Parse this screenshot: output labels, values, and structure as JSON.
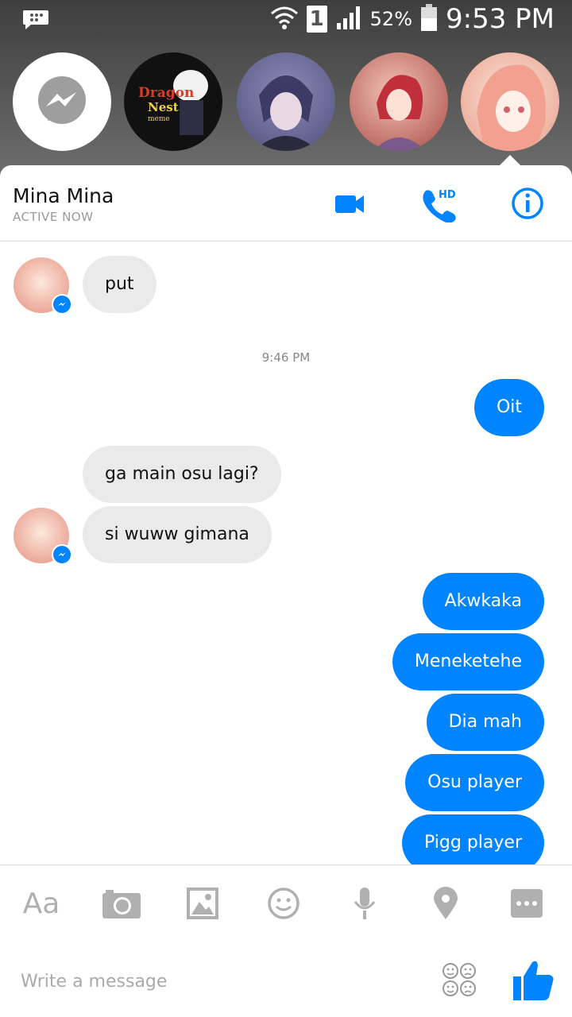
{
  "status_bar": {
    "battery_percent": "52%",
    "time": "9:53 PM",
    "sim_slot": "1"
  },
  "chat_heads": [
    {
      "name": "messenger-head",
      "icon": "messenger-icon"
    },
    {
      "name": "dragon-nest-head",
      "text": "Dragon Nest meme"
    },
    {
      "name": "contact-head-2"
    },
    {
      "name": "contact-head-3"
    },
    {
      "name": "contact-head-mina-active"
    }
  ],
  "header": {
    "contact_name": "Mina Mina",
    "status": "ACTIVE NOW",
    "call_hd_label": "HD"
  },
  "thread": {
    "timestamp": "9:46 PM",
    "messages": [
      {
        "from": "them",
        "text": "put"
      },
      {
        "from": "me",
        "text": "Oit"
      },
      {
        "from": "them",
        "text": "ga main osu lagi?"
      },
      {
        "from": "them",
        "text": "si wuww gimana"
      },
      {
        "from": "me",
        "text": "Akwkaka"
      },
      {
        "from": "me",
        "text": "Meneketehe"
      },
      {
        "from": "me",
        "text": "Dia mah"
      },
      {
        "from": "me",
        "text": "Osu player"
      },
      {
        "from": "me",
        "text": "Pigg player"
      }
    ]
  },
  "composer": {
    "text_tool_label": "Aa",
    "placeholder": "Write a message",
    "value": ""
  },
  "colors": {
    "accent": "#0084ff",
    "incoming_bubble": "#eaeaea",
    "icon_grey": "#b0b0b0"
  }
}
